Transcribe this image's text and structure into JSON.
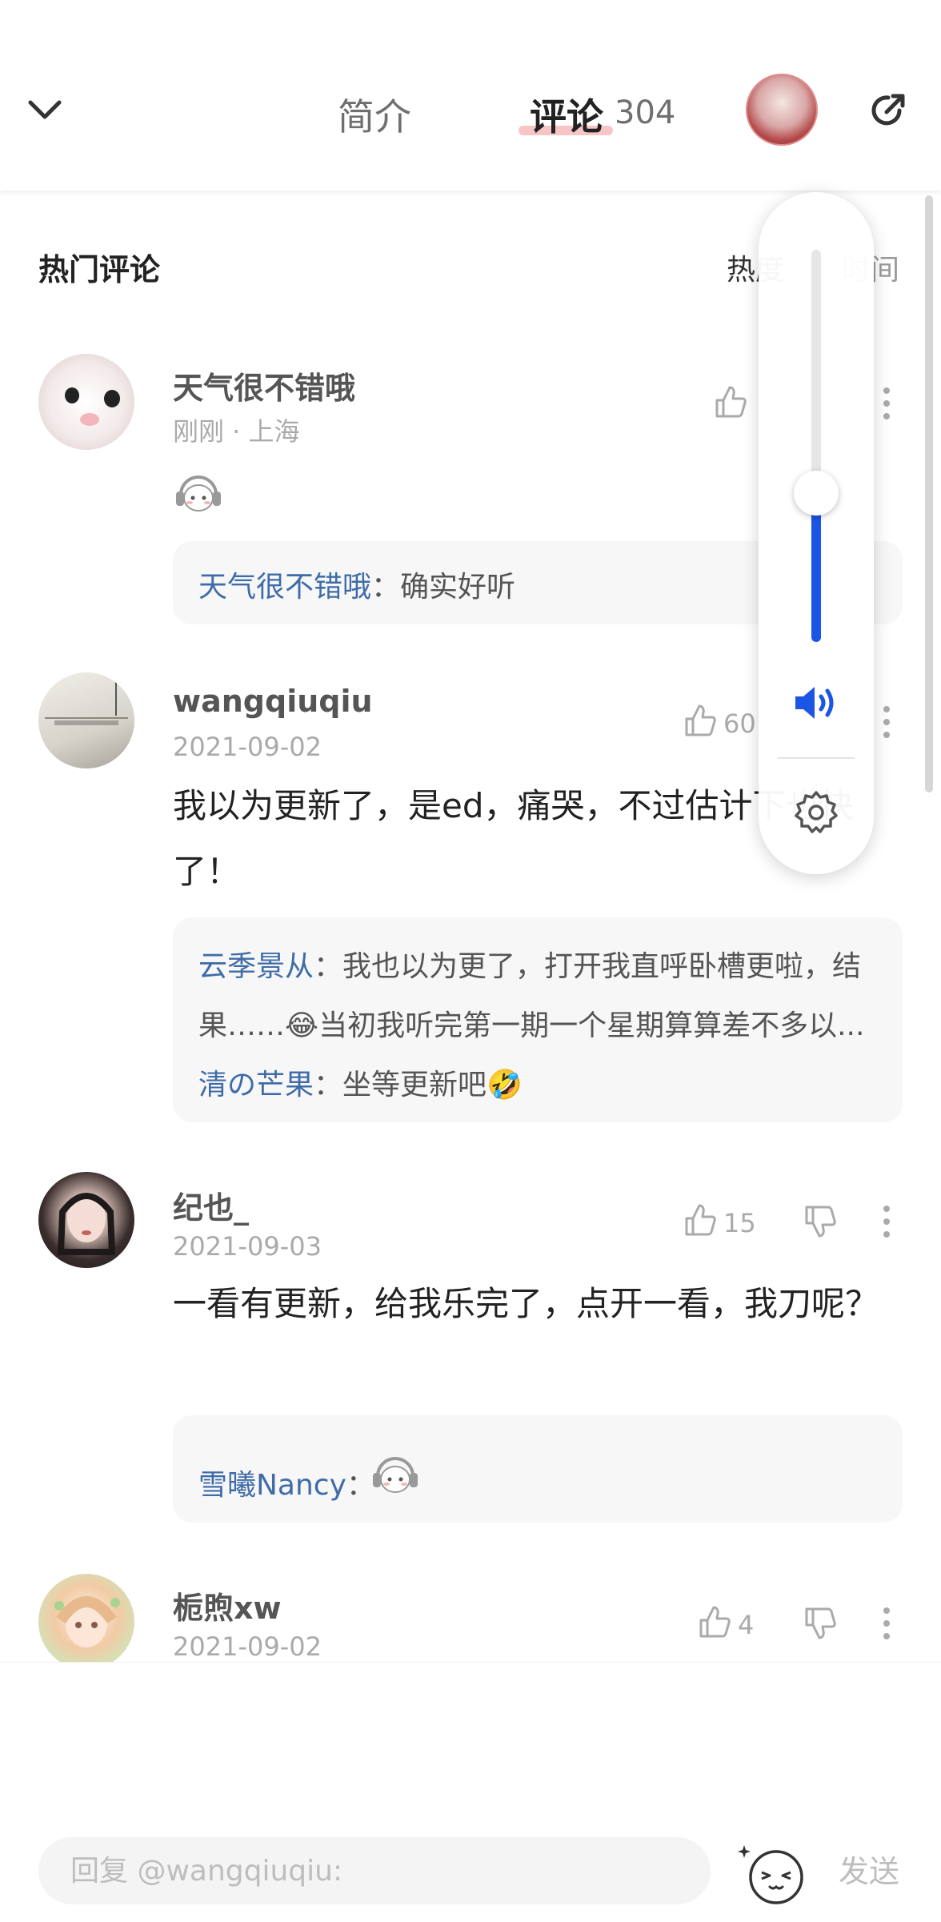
{
  "header": {
    "tab_intro": "简介",
    "tab_comments": "评论",
    "comment_count": "304"
  },
  "section": {
    "title": "热门评论",
    "sort_hot": "热度",
    "sort_time": "时间"
  },
  "comments": [
    {
      "author": "天气很不错哦",
      "meta": "刚刚 · 上海",
      "likes": "",
      "body": "",
      "replies": [
        {
          "name": "天气很不错哦",
          "text": "确实好听"
        }
      ]
    },
    {
      "author": "wangqiuqiu",
      "meta": "2021-09-02",
      "likes": "60",
      "body": "我以为更新了，是ed，痛哭，不过估计下也快了！",
      "replies": [
        {
          "name": "云季景从",
          "text": "我也以为更了，打开我直呼卧槽更啦，结"
        },
        {
          "name": "",
          "text": "果……😂当初我听完第一期一个星期算算差不多以..."
        },
        {
          "name": "清の芒果",
          "text": "坐等更新吧🤣"
        }
      ]
    },
    {
      "author": "纪也_",
      "meta": "2021-09-03",
      "likes": "15",
      "body": "一看有更新，给我乐完了，点开一看，我刀呢？",
      "replies": [
        {
          "name": "雪曦Nancy",
          "text": ""
        }
      ]
    },
    {
      "author": "栀煦xw",
      "meta": "2021-09-02",
      "likes": "4",
      "body": "",
      "replies": []
    }
  ],
  "volume": {
    "level": 0.38,
    "accent": "#1a55e6"
  },
  "bottom": {
    "placeholder": "回复 @wangqiuqiu:",
    "send_label": "发送"
  },
  "icons": [
    "chevron-down-icon",
    "share-icon",
    "thumb-up-icon",
    "thumb-down-icon",
    "more-icon",
    "speaker-icon",
    "gear-icon",
    "emoji-icon"
  ]
}
